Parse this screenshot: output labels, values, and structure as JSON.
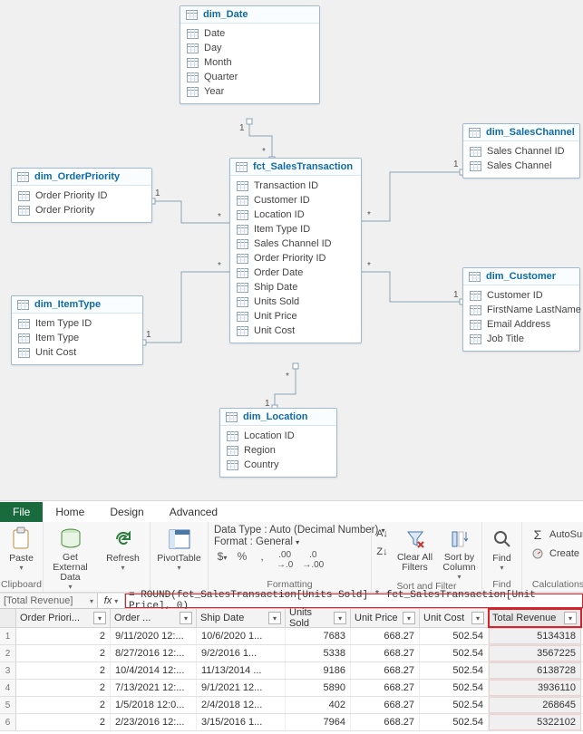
{
  "diagram": {
    "entities": [
      {
        "id": "dim_Date",
        "title": "dim_Date",
        "fields": [
          "Date",
          "Day",
          "Month",
          "Quarter",
          "Year"
        ]
      },
      {
        "id": "dim_SalesChannel",
        "title": "dim_SalesChannel",
        "fields": [
          "Sales Channel ID",
          "Sales Channel"
        ]
      },
      {
        "id": "dim_OrderPriority",
        "title": "dim_OrderPriority",
        "fields": [
          "Order Priority ID",
          "Order Priority"
        ]
      },
      {
        "id": "fct_SalesTransaction",
        "title": "fct_SalesTransaction",
        "fields": [
          "Transaction ID",
          "Customer ID",
          "Location ID",
          "Item Type ID",
          "Sales Channel ID",
          "Order Priority ID",
          "Order Date",
          "Ship Date",
          "Units Sold",
          "Unit Price",
          "Unit Cost"
        ]
      },
      {
        "id": "dim_Customer",
        "title": "dim_Customer",
        "fields": [
          "Customer ID",
          "FirstName LastName",
          "Email Address",
          "Job Title"
        ]
      },
      {
        "id": "dim_ItemType",
        "title": "dim_ItemType",
        "fields": [
          "Item Type ID",
          "Item Type",
          "Unit Cost"
        ]
      },
      {
        "id": "dim_Location",
        "title": "dim_Location",
        "fields": [
          "Location ID",
          "Region",
          "Country"
        ]
      }
    ],
    "cards": {
      "one": "1",
      "many": "*"
    }
  },
  "ribbon": {
    "tabs": [
      "File",
      "Home",
      "Design",
      "Advanced"
    ],
    "activeTab": "File",
    "groups": {
      "clipboard": {
        "paste": "Paste",
        "label": "Clipboard"
      },
      "extdata": {
        "get": "Get External Data",
        "refresh": "Refresh"
      },
      "pivot": {
        "pivot": "PivotTable"
      },
      "formatting": {
        "dt_label": "Data Type : ",
        "dt_value": "Auto (Decimal Number)",
        "fmt_label": "Format : ",
        "fmt_value": "General",
        "symbols": [
          "$",
          "%",
          "‚",
          ".00 →.0",
          ".0 →.00"
        ],
        "label": "Formatting"
      },
      "sortfilter": {
        "sortaz": "A→Z",
        "clear": "Clear All Filters",
        "sortby": "Sort by Column",
        "label": "Sort and Filter"
      },
      "find": {
        "find": "Find",
        "label": "Find"
      },
      "calc": {
        "autosum": "AutoSum",
        "kpi": "Create KPI",
        "label": "Calculations"
      }
    }
  },
  "formula_bar": {
    "name": "[Total Revenue]",
    "fx": "fx",
    "formula": "= ROUND(fct_SalesTransaction[Units Sold] * fct_SalesTransaction[Unit Price], 0)"
  },
  "grid": {
    "columns": [
      {
        "key": "op",
        "label": "Order Priori...",
        "cls": "c-op",
        "align": "n"
      },
      {
        "key": "od",
        "label": "Order ...",
        "cls": "c-od",
        "align": ""
      },
      {
        "key": "sd",
        "label": "Ship Date",
        "cls": "c-sd",
        "align": ""
      },
      {
        "key": "us",
        "label": "Units Sold",
        "cls": "c-us",
        "align": "n"
      },
      {
        "key": "up",
        "label": "Unit Price",
        "cls": "c-up",
        "align": "n"
      },
      {
        "key": "uc",
        "label": "Unit Cost",
        "cls": "c-uc",
        "align": "n"
      },
      {
        "key": "tr",
        "label": "Total Revenue",
        "cls": "c-tr",
        "align": "rev",
        "last": true
      }
    ],
    "rows": [
      {
        "op": "2",
        "od": "9/11/2020 12:...",
        "sd": "10/6/2020 1...",
        "us": "7683",
        "up": "668.27",
        "uc": "502.54",
        "tr": "5134318"
      },
      {
        "op": "2",
        "od": "8/27/2016 12:...",
        "sd": "9/2/2016 1...",
        "us": "5338",
        "up": "668.27",
        "uc": "502.54",
        "tr": "3567225"
      },
      {
        "op": "2",
        "od": "10/4/2014 12:...",
        "sd": "11/13/2014 ...",
        "us": "9186",
        "up": "668.27",
        "uc": "502.54",
        "tr": "6138728"
      },
      {
        "op": "2",
        "od": "7/13/2021 12:...",
        "sd": "9/1/2021 12...",
        "us": "5890",
        "up": "668.27",
        "uc": "502.54",
        "tr": "3936110"
      },
      {
        "op": "2",
        "od": "1/5/2018 12:0...",
        "sd": "2/4/2018 12...",
        "us": "402",
        "up": "668.27",
        "uc": "502.54",
        "tr": "268645"
      },
      {
        "op": "2",
        "od": "2/23/2016 12:...",
        "sd": "3/15/2016 1...",
        "us": "7964",
        "up": "668.27",
        "uc": "502.54",
        "tr": "5322102"
      }
    ]
  }
}
